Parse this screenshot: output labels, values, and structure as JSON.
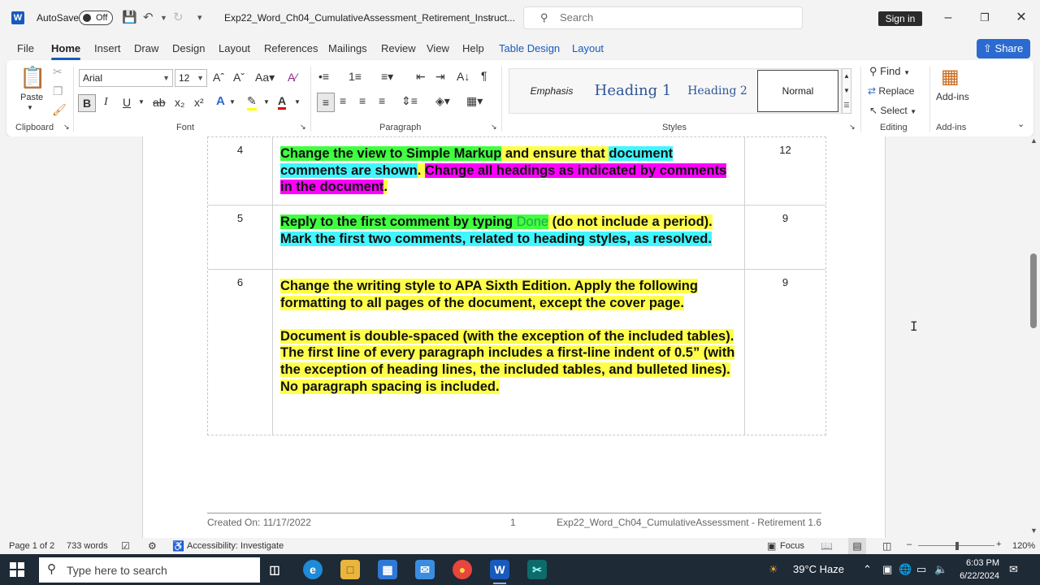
{
  "titlebar": {
    "autosave_label": "AutoSave",
    "autosave_state": "Off",
    "doc_title": "Exp22_Word_Ch04_CumulativeAssessment_Retirement_Instruct...",
    "search_placeholder": "Search",
    "signin_label": "Sign in"
  },
  "menu": {
    "tabs": [
      "File",
      "Home",
      "Insert",
      "Draw",
      "Design",
      "Layout",
      "References",
      "Mailings",
      "Review",
      "View",
      "Help",
      "Table Design",
      "Layout"
    ],
    "active_tab": "Home",
    "share_label": "Share"
  },
  "ribbon": {
    "clipboard": {
      "paste_label": "Paste",
      "group_label": "Clipboard"
    },
    "font": {
      "family": "Arial",
      "size": "12",
      "group_label": "Font"
    },
    "paragraph": {
      "group_label": "Paragraph"
    },
    "styles": {
      "items": [
        "Emphasis",
        "Heading 1",
        "Heading 2",
        "Normal"
      ],
      "selected": "Normal",
      "group_label": "Styles"
    },
    "editing": {
      "find_label": "Find",
      "replace_label": "Replace",
      "select_label": "Select",
      "group_label": "Editing"
    },
    "addins": {
      "button_label": "Add-ins",
      "group_label": "Add-ins"
    }
  },
  "document": {
    "rows": [
      {
        "num": "4",
        "points": "12",
        "parts": [
          {
            "t": "Change the view to Simple Markup",
            "h": "g"
          },
          {
            "t": " and ensure that ",
            "h": "y"
          },
          {
            "t": "document comments are shown",
            "h": "c"
          },
          {
            "t": ". ",
            "h": "y"
          },
          {
            "t": "Change all headings as indicated by comments in the document",
            "h": "m"
          },
          {
            "t": ".",
            "h": "y"
          }
        ]
      },
      {
        "num": "5",
        "points": "9",
        "parts": [
          {
            "t": "Reply to the first comment by typing ",
            "h": "g"
          },
          {
            "t": "Done",
            "h": "done"
          },
          {
            "t": " (do not include a period). ",
            "h": "y"
          },
          {
            "t": "Mark the first two comments, related to heading styles, as resolved.",
            "h": "c"
          }
        ]
      },
      {
        "num": "6",
        "points": "9",
        "paragraphs": [
          "Change the writing style to APA Sixth Edition. Apply the following formatting to all pages of the document, except the cover page.",
          "",
          "Document is double-spaced (with the exception of the included tables).",
          "The first line of every paragraph includes a first-line indent of 0.5” (with the exception of heading lines, the included tables, and bulleted lines).",
          "No paragraph spacing is included."
        ]
      }
    ],
    "footer": {
      "created": "Created On: 11/17/2022",
      "page": "1",
      "name": "Exp22_Word_Ch04_CumulativeAssessment - Retirement 1.6"
    }
  },
  "statusbar": {
    "page": "Page 1 of 2",
    "words": "733 words",
    "accessibility": "Accessibility: Investigate",
    "focus": "Focus",
    "zoom": "120%"
  },
  "taskbar": {
    "search_placeholder": "Type here to search",
    "weather": "39°C  Haze",
    "time": "6:03 PM",
    "date": "6/22/2024"
  },
  "colors": {
    "word_blue": "#185abd",
    "highlight_yellow": "#ffff4a",
    "highlight_green": "#40ff40",
    "highlight_cyan": "#40f6ff",
    "highlight_magenta": "#ff00ff"
  }
}
